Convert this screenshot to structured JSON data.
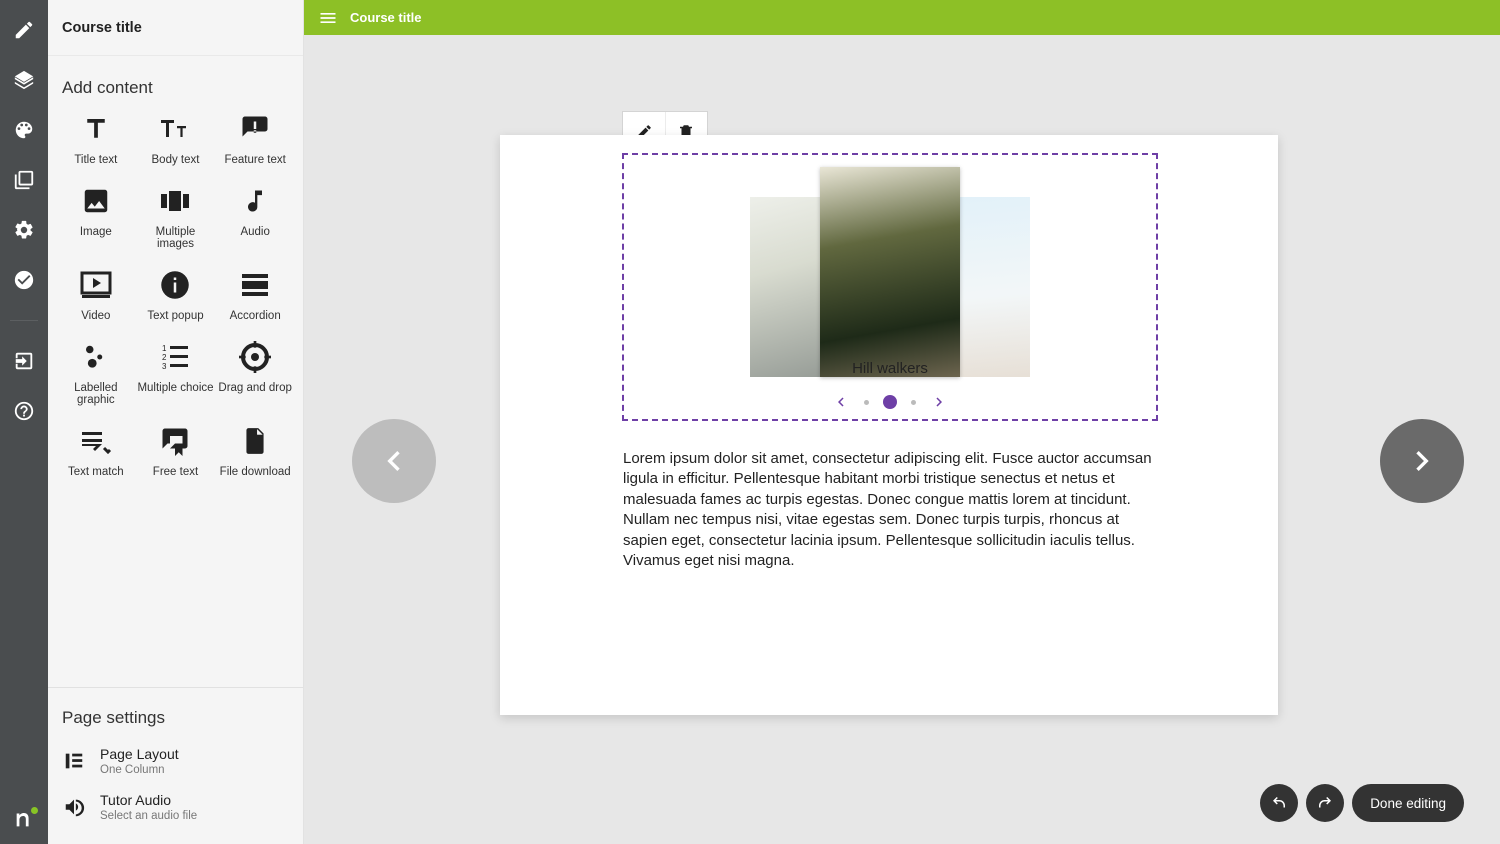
{
  "sidebar": {
    "title": "Course title",
    "section_add": "Add content",
    "items": [
      {
        "label": "Title text"
      },
      {
        "label": "Body text"
      },
      {
        "label": "Feature text"
      },
      {
        "label": "Image"
      },
      {
        "label": "Multiple images"
      },
      {
        "label": "Audio"
      },
      {
        "label": "Video"
      },
      {
        "label": "Text popup"
      },
      {
        "label": "Accordion"
      },
      {
        "label": "Labelled graphic"
      },
      {
        "label": "Multiple choice"
      },
      {
        "label": "Drag and drop"
      },
      {
        "label": "Text match"
      },
      {
        "label": "Free text"
      },
      {
        "label": "File download"
      }
    ],
    "section_settings": "Page settings",
    "settings": [
      {
        "title": "Page Layout",
        "sub": "One Column"
      },
      {
        "title": "Tutor Audio",
        "sub": "Select an audio file"
      }
    ]
  },
  "topbar": {
    "title": "Course title"
  },
  "carousel": {
    "caption": "Hill walkers",
    "active_index": 1,
    "count": 3
  },
  "body_text": "Lorem ipsum dolor sit amet, consectetur adipiscing elit. Fusce auctor accumsan ligula in efficitur. Pellentesque habitant morbi tristique senectus et netus et malesuada fames ac turpis egestas. Donec congue mattis lorem at tincidunt. Nullam nec tempus nisi, vitae egestas sem. Donec turpis turpis, rhoncus at sapien eget, consectetur lacinia ipsum. Pellentesque sollicitudin iaculis tellus. Vivamus eget nisi magna.",
  "footer": {
    "done": "Done editing"
  },
  "colors": {
    "accent": "#8dc026",
    "selection": "#6e3fa6"
  }
}
